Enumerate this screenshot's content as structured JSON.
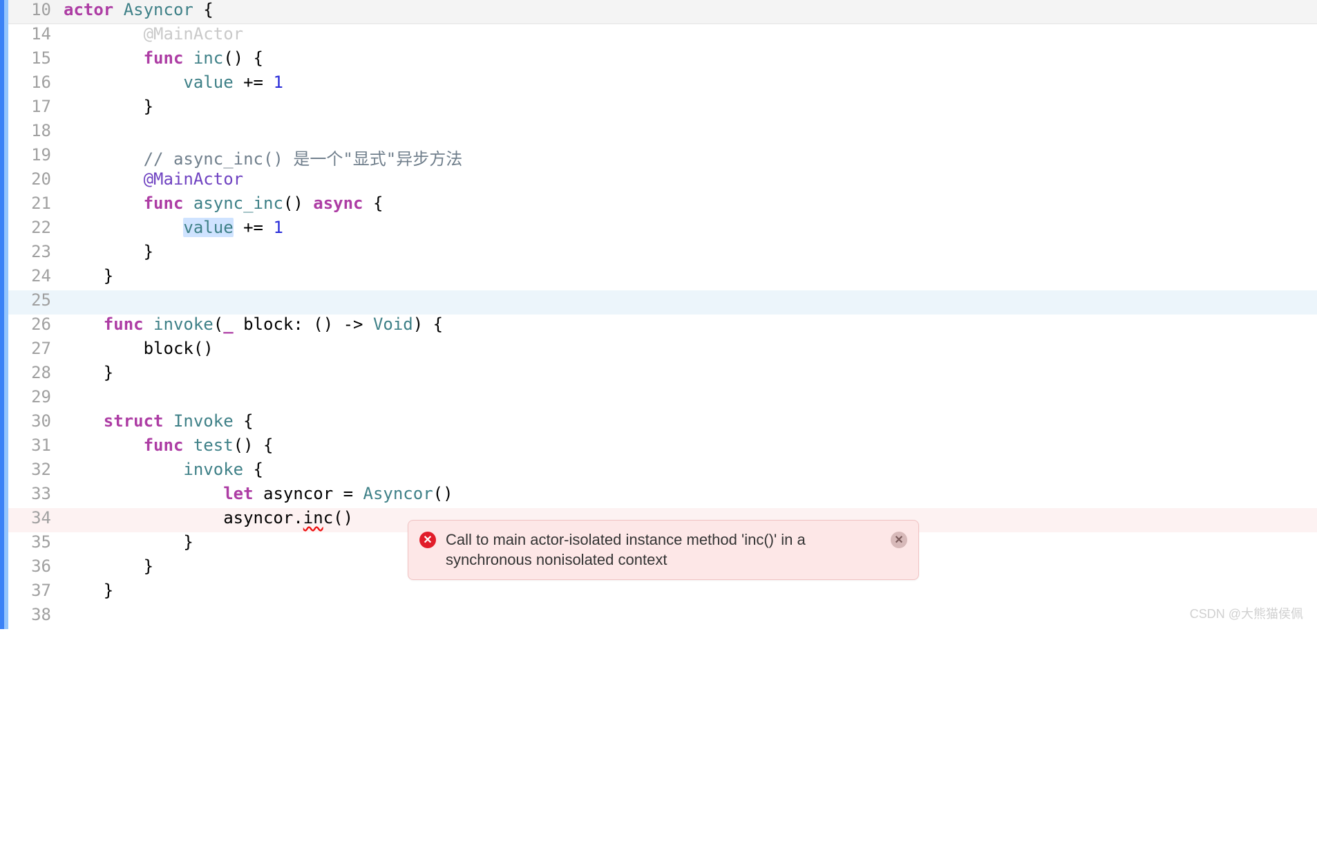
{
  "pinned_line_number": "10",
  "lines": [
    {
      "n": "14",
      "bg": "",
      "tokens": [
        {
          "indent": "        ",
          "cls": "faded-top",
          "t": "@MainActor"
        }
      ]
    },
    {
      "n": "15",
      "tokens": [
        {
          "indent": "        "
        },
        {
          "cls": "kw",
          "t": "func"
        },
        {
          "t": " "
        },
        {
          "cls": "fn",
          "t": "inc"
        },
        {
          "t": "() {"
        }
      ]
    },
    {
      "n": "16",
      "tokens": [
        {
          "indent": "            "
        },
        {
          "cls": "ident",
          "t": "value"
        },
        {
          "t": " "
        },
        {
          "cls": "op",
          "t": "+="
        },
        {
          "t": " "
        },
        {
          "cls": "num",
          "t": "1"
        }
      ]
    },
    {
      "n": "17",
      "tokens": [
        {
          "indent": "        "
        },
        {
          "t": "}"
        }
      ]
    },
    {
      "n": "18",
      "tokens": [
        {
          "t": ""
        }
      ]
    },
    {
      "n": "19",
      "tokens": [
        {
          "indent": "        "
        },
        {
          "cls": "comment",
          "t": "// async_inc() 是一个\"显式\"异步方法"
        }
      ]
    },
    {
      "n": "20",
      "tokens": [
        {
          "indent": "        "
        },
        {
          "cls": "attr",
          "t": "@MainActor"
        }
      ]
    },
    {
      "n": "21",
      "tokens": [
        {
          "indent": "        "
        },
        {
          "cls": "kw",
          "t": "func"
        },
        {
          "t": " "
        },
        {
          "cls": "fn",
          "t": "async_inc"
        },
        {
          "t": "() "
        },
        {
          "cls": "kw",
          "t": "async"
        },
        {
          "t": " {"
        }
      ]
    },
    {
      "n": "22",
      "tokens": [
        {
          "indent": "            "
        },
        {
          "cls": "ident sel",
          "t": "value"
        },
        {
          "t": " "
        },
        {
          "cls": "op",
          "t": "+="
        },
        {
          "t": " "
        },
        {
          "cls": "num",
          "t": "1"
        }
      ]
    },
    {
      "n": "23",
      "tokens": [
        {
          "indent": "        "
        },
        {
          "t": "}"
        }
      ]
    },
    {
      "n": "24",
      "tokens": [
        {
          "indent": "    "
        },
        {
          "t": "}"
        }
      ]
    },
    {
      "n": "25",
      "bg": "highlight-row",
      "tokens": [
        {
          "t": ""
        }
      ]
    },
    {
      "n": "26",
      "tokens": [
        {
          "indent": "    "
        },
        {
          "cls": "kw",
          "t": "func"
        },
        {
          "t": " "
        },
        {
          "cls": "fn",
          "t": "invoke"
        },
        {
          "t": "("
        },
        {
          "cls": "kw",
          "t": "_"
        },
        {
          "t": " block: () -> "
        },
        {
          "cls": "type",
          "t": "Void"
        },
        {
          "t": ") {"
        }
      ]
    },
    {
      "n": "27",
      "tokens": [
        {
          "indent": "        "
        },
        {
          "t": "block()"
        }
      ]
    },
    {
      "n": "28",
      "tokens": [
        {
          "indent": "    "
        },
        {
          "t": "}"
        }
      ]
    },
    {
      "n": "29",
      "tokens": [
        {
          "t": ""
        }
      ]
    },
    {
      "n": "30",
      "tokens": [
        {
          "indent": "    "
        },
        {
          "cls": "kw",
          "t": "struct"
        },
        {
          "t": " "
        },
        {
          "cls": "type",
          "t": "Invoke"
        },
        {
          "t": " {"
        }
      ]
    },
    {
      "n": "31",
      "tokens": [
        {
          "indent": "        "
        },
        {
          "cls": "kw",
          "t": "func"
        },
        {
          "t": " "
        },
        {
          "cls": "fn",
          "t": "test"
        },
        {
          "t": "() {"
        }
      ]
    },
    {
      "n": "32",
      "tokens": [
        {
          "indent": "            "
        },
        {
          "cls": "ident",
          "t": "invoke"
        },
        {
          "t": " {"
        }
      ]
    },
    {
      "n": "33",
      "tokens": [
        {
          "indent": "                "
        },
        {
          "cls": "kw",
          "t": "let"
        },
        {
          "t": " asyncor = "
        },
        {
          "cls": "type",
          "t": "Asyncor"
        },
        {
          "t": "()"
        }
      ]
    },
    {
      "n": "34",
      "bg": "error-row-bg",
      "tokens": [
        {
          "indent": "                "
        },
        {
          "t": "asyncor."
        },
        {
          "cls": "err-underline",
          "t": "in"
        },
        {
          "t": "c()"
        }
      ]
    },
    {
      "n": "35",
      "tokens": [
        {
          "indent": "            "
        },
        {
          "t": "}"
        }
      ]
    },
    {
      "n": "36",
      "tokens": [
        {
          "indent": "        "
        },
        {
          "t": "}"
        }
      ]
    },
    {
      "n": "37",
      "tokens": [
        {
          "indent": "    "
        },
        {
          "t": "}"
        }
      ]
    },
    {
      "n": "38",
      "tokens": [
        {
          "t": ""
        }
      ]
    }
  ],
  "pinned_tokens": [
    {
      "cls": "kw",
      "t": "actor"
    },
    {
      "t": " "
    },
    {
      "cls": "type",
      "t": "Asyncor"
    },
    {
      "t": " {"
    }
  ],
  "error": {
    "message": "Call to main actor-isolated instance method 'inc()' in a synchronous nonisolated context"
  },
  "watermark": "CSDN @大熊猫侯佩"
}
